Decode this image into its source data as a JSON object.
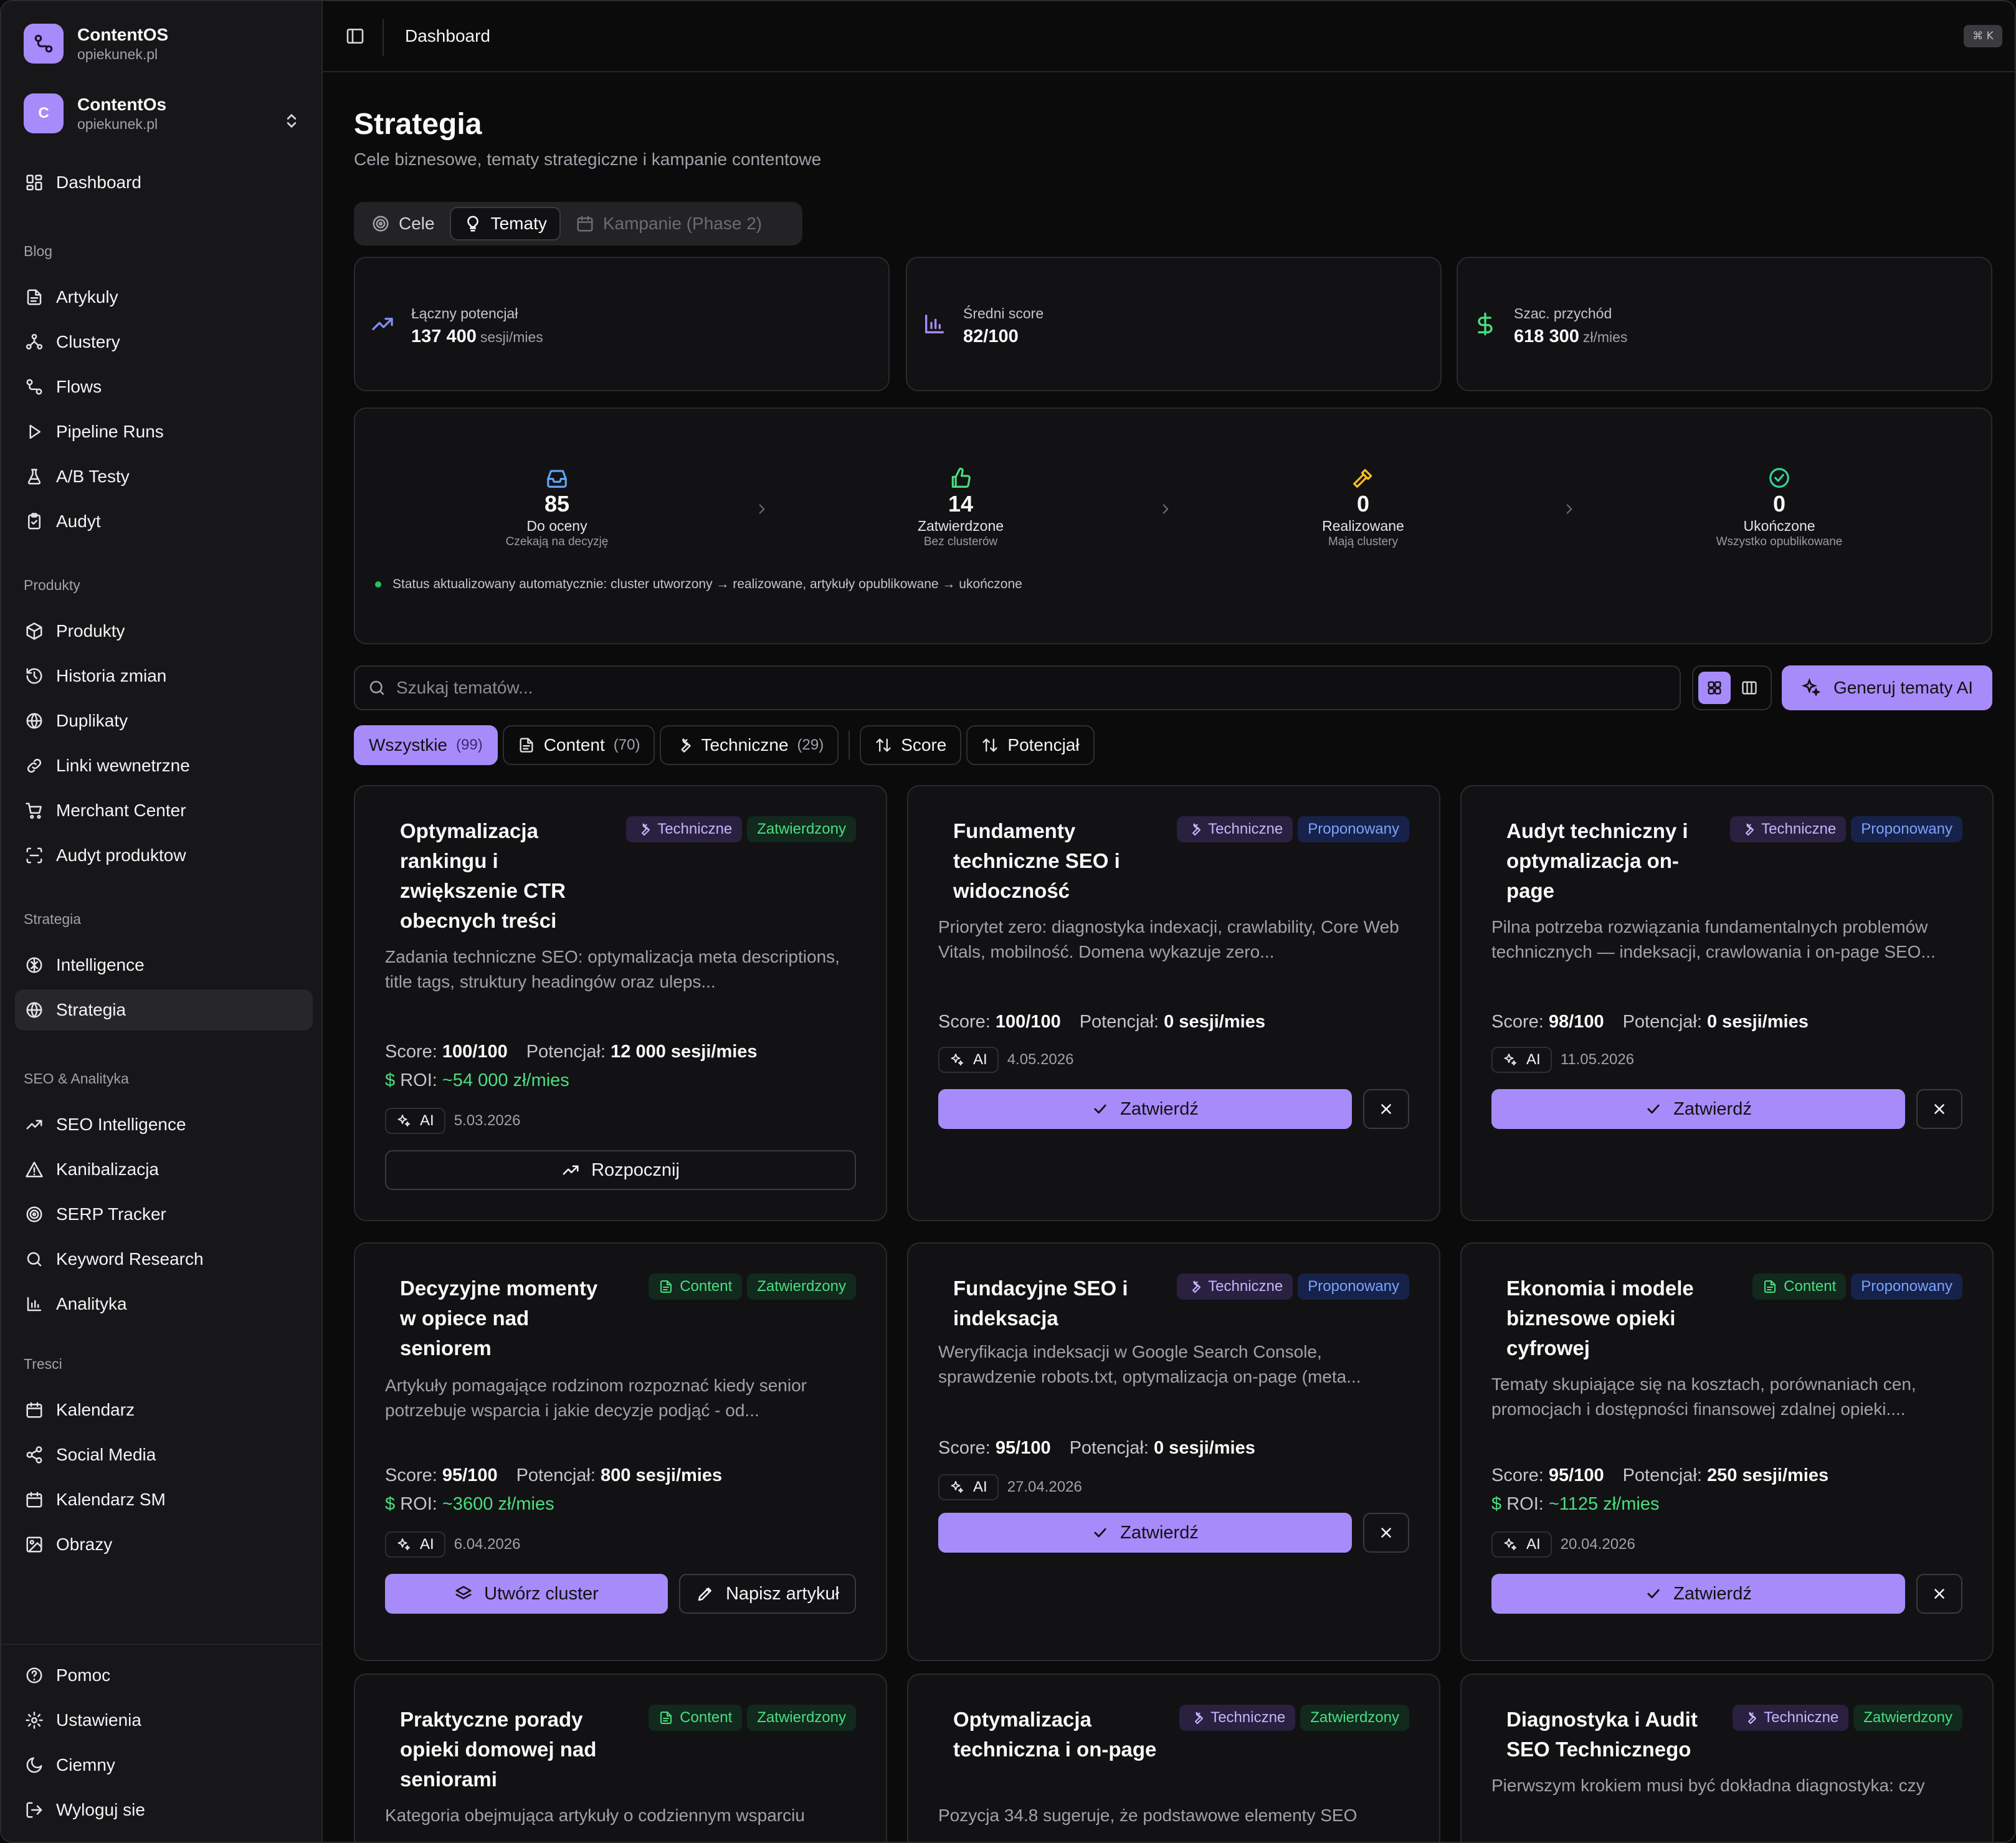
{
  "workspace": {
    "name": "ContentOS",
    "domain": "opiekunek.pl"
  },
  "account": {
    "initial": "C",
    "name": "ContentOs",
    "domain": "opiekunek.pl"
  },
  "sidebar": {
    "top": [
      {
        "label": "Dashboard",
        "icon": "dashboard-icon"
      }
    ],
    "sections": [
      {
        "title": "Blog",
        "items": [
          {
            "label": "Artykuly",
            "icon": "file-text-icon"
          },
          {
            "label": "Clustery",
            "icon": "clusters-icon"
          },
          {
            "label": "Flows",
            "icon": "flows-icon"
          },
          {
            "label": "Pipeline Runs",
            "icon": "play-icon"
          },
          {
            "label": "A/B Testy",
            "icon": "flask-icon"
          },
          {
            "label": "Audyt",
            "icon": "clipboard-icon"
          }
        ]
      },
      {
        "title": "Produkty",
        "items": [
          {
            "label": "Produkty",
            "icon": "package-icon"
          },
          {
            "label": "Historia zmian",
            "icon": "history-icon"
          },
          {
            "label": "Duplikaty",
            "icon": "globe-icon"
          },
          {
            "label": "Linki wewnetrzne",
            "icon": "link-icon"
          },
          {
            "label": "Merchant Center",
            "icon": "cart-icon"
          },
          {
            "label": "Audyt produktow",
            "icon": "scan-icon"
          }
        ]
      },
      {
        "title": "Strategia",
        "items": [
          {
            "label": "Intelligence",
            "icon": "brain-icon"
          },
          {
            "label": "Strategia",
            "icon": "globe-icon"
          }
        ]
      },
      {
        "title": "SEO & Analityka",
        "items": [
          {
            "label": "SEO Intelligence",
            "icon": "trending-up-icon"
          },
          {
            "label": "Kanibalizacja",
            "icon": "warning-icon"
          },
          {
            "label": "SERP Tracker",
            "icon": "target-icon"
          },
          {
            "label": "Keyword Research",
            "icon": "search-icon"
          },
          {
            "label": "Analityka",
            "icon": "bar-chart-icon"
          }
        ]
      },
      {
        "title": "Tresci",
        "items": [
          {
            "label": "Kalendarz",
            "icon": "calendar-icon"
          },
          {
            "label": "Social Media",
            "icon": "share-icon"
          },
          {
            "label": "Kalendarz SM",
            "icon": "calendar-icon"
          },
          {
            "label": "Obrazy",
            "icon": "image-icon"
          }
        ]
      }
    ],
    "footer": [
      {
        "label": "Pomoc",
        "icon": "help-icon"
      },
      {
        "label": "Ustawienia",
        "icon": "gear-icon"
      },
      {
        "label": "Ciemny",
        "icon": "moon-icon"
      },
      {
        "label": "Wyloguj sie",
        "icon": "logout-icon"
      }
    ],
    "active": "Strategia"
  },
  "topbar": {
    "breadcrumb": "Dashboard",
    "shortcut": "⌘ K"
  },
  "page": {
    "title": "Strategia",
    "subtitle": "Cele biznesowe, tematy strategiczne i kampanie contentowe"
  },
  "tabs": [
    {
      "label": "Cele",
      "icon": "target-icon",
      "state": "normal"
    },
    {
      "label": "Tematy",
      "icon": "lightbulb-icon",
      "state": "active"
    },
    {
      "label": "Kampanie (Phase 2)",
      "icon": "calendar-icon",
      "state": "disabled"
    }
  ],
  "stats": [
    {
      "label": "Łączny potencjał",
      "value": "137 400",
      "unit": "sesji/mies",
      "icon": "trending-up-icon",
      "color": "#818cf8"
    },
    {
      "label": "Średni score",
      "value": "82/100",
      "unit": "",
      "icon": "bar-chart-icon",
      "color": "#a78bfa"
    },
    {
      "label": "Szac. przychód",
      "value": "618 300",
      "unit": "zł/mies",
      "icon": "dollar-icon",
      "color": "#4ade80"
    }
  ],
  "pipeline": {
    "steps": [
      {
        "count": "85",
        "name": "Do oceny",
        "desc": "Czekają na decyzję",
        "icon": "inbox-icon",
        "color": "#60a5fa"
      },
      {
        "count": "14",
        "name": "Zatwierdzone",
        "desc": "Bez clusterów",
        "icon": "thumbs-up-icon",
        "color": "#4ade80"
      },
      {
        "count": "0",
        "name": "Realizowane",
        "desc": "Mają clustery",
        "icon": "hammer-icon",
        "color": "#fbbf24"
      },
      {
        "count": "0",
        "name": "Ukończone",
        "desc": "Wszystko opublikowane",
        "icon": "check-circle-icon",
        "color": "#34d399"
      }
    ],
    "note": "Status aktualizowany automatycznie: cluster utworzony → realizowane, artykuły opublikowane → ukończone"
  },
  "search": {
    "placeholder": "Szukaj tematów...",
    "value": ""
  },
  "generate_button": "Generuj tematy AI",
  "filters": [
    {
      "label": "Wszystkie",
      "count": "(99)",
      "icon": "",
      "active": true
    },
    {
      "label": "Content",
      "count": "(70)",
      "icon": "file-icon",
      "active": false
    },
    {
      "label": "Techniczne",
      "count": "(29)",
      "icon": "wrench-icon",
      "active": false
    }
  ],
  "sorts": [
    {
      "label": "Score",
      "icon": "sort-icon"
    },
    {
      "label": "Potencjał",
      "icon": "sort-icon"
    }
  ],
  "labels": {
    "score": "Score:",
    "potential": "Potencjał:",
    "roi": "ROI:",
    "ai": "AI"
  },
  "topics": [
    {
      "title": "Optymalizacja rankingu i zwiększenie CTR obecnych treści",
      "type": "Techniczne",
      "status": "Zatwierdzony",
      "desc": "Zadania techniczne SEO: optymalizacja meta descriptions, title tags, struktury headingów oraz uleps...",
      "score": "100/100",
      "potential": "12 000 sesji/mies",
      "roi": "~54 000 zł/mies",
      "date": "5.03.2026",
      "actions": [
        "Rozpocznij"
      ]
    },
    {
      "title": "Fundamenty techniczne SEO i widoczność",
      "type": "Techniczne",
      "status": "Proponowany",
      "desc": "Priorytet zero: diagnostyka indexacji, crawlability, Core Web Vitals, mobilność. Domena wykazuje zero...",
      "score": "100/100",
      "potential": "0 sesji/mies",
      "roi": "",
      "date": "4.05.2026",
      "actions": [
        "Zatwierdź"
      ]
    },
    {
      "title": "Audyt techniczny i optymalizacja on-page",
      "type": "Techniczne",
      "status": "Proponowany",
      "desc": "Pilna potrzeba rozwiązania fundamentalnych problemów technicznych — indeksacji, crawlowania i on-page SEO...",
      "score": "98/100",
      "potential": "0 sesji/mies",
      "roi": "",
      "date": "11.05.2026",
      "actions": [
        "Zatwierdź"
      ]
    },
    {
      "title": "Decyzyjne momenty w opiece nad seniorem",
      "type": "Content",
      "status": "Zatwierdzony",
      "desc": "Artykuły pomagające rodzinom rozpoznać kiedy senior potrzebuje wsparcia i jakie decyzje podjąć - od...",
      "score": "95/100",
      "potential": "800 sesji/mies",
      "roi": "~3600 zł/mies",
      "date": "6.04.2026",
      "actions": [
        "Utwórz cluster",
        "Napisz artykuł"
      ]
    },
    {
      "title": "Fundacyjne SEO i indeksacja",
      "type": "Techniczne",
      "status": "Proponowany",
      "desc": "Weryfikacja indeksacji w Google Search Console, sprawdzenie robots.txt, optymalizacja on-page (meta...",
      "score": "95/100",
      "potential": "0 sesji/mies",
      "roi": "",
      "date": "27.04.2026",
      "actions": [
        "Zatwierdź"
      ]
    },
    {
      "title": "Ekonomia i modele biznesowe opieki cyfrowej",
      "type": "Content",
      "status": "Proponowany",
      "desc": "Tematy skupiające się na kosztach, porównaniach cen, promocjach i dostępności finansowej zdalnej opieki....",
      "score": "95/100",
      "potential": "250 sesji/mies",
      "roi": "~1125 zł/mies",
      "date": "20.04.2026",
      "actions": [
        "Zatwierdź"
      ]
    },
    {
      "title": "Praktyczne porady opieki domowej nad seniorami",
      "type": "Content",
      "status": "Zatwierdzony",
      "desc": "Kategoria obejmująca artykuły o codziennym wsparciu",
      "score": "",
      "potential": "",
      "roi": "",
      "date": "",
      "actions": []
    },
    {
      "title": "Optymalizacja techniczna i on-page",
      "type": "Techniczne",
      "status": "Zatwierdzony",
      "desc": "Pozycja 34.8 sugeruje, że podstawowe elementy SEO",
      "score": "",
      "potential": "",
      "roi": "",
      "date": "",
      "actions": []
    },
    {
      "title": "Diagnostyka i Audit SEO Technicznego",
      "type": "Techniczne",
      "status": "Zatwierdzony",
      "desc": "Pierwszym krokiem musi być dokładna diagnostyka: czy",
      "score": "",
      "potential": "",
      "roi": "",
      "date": "",
      "actions": []
    }
  ],
  "colors": {
    "accent": "#a78bfa",
    "background": "#0b0b0c",
    "card": "#121214",
    "green": "#4ade80",
    "blue": "#7aa2ff"
  }
}
